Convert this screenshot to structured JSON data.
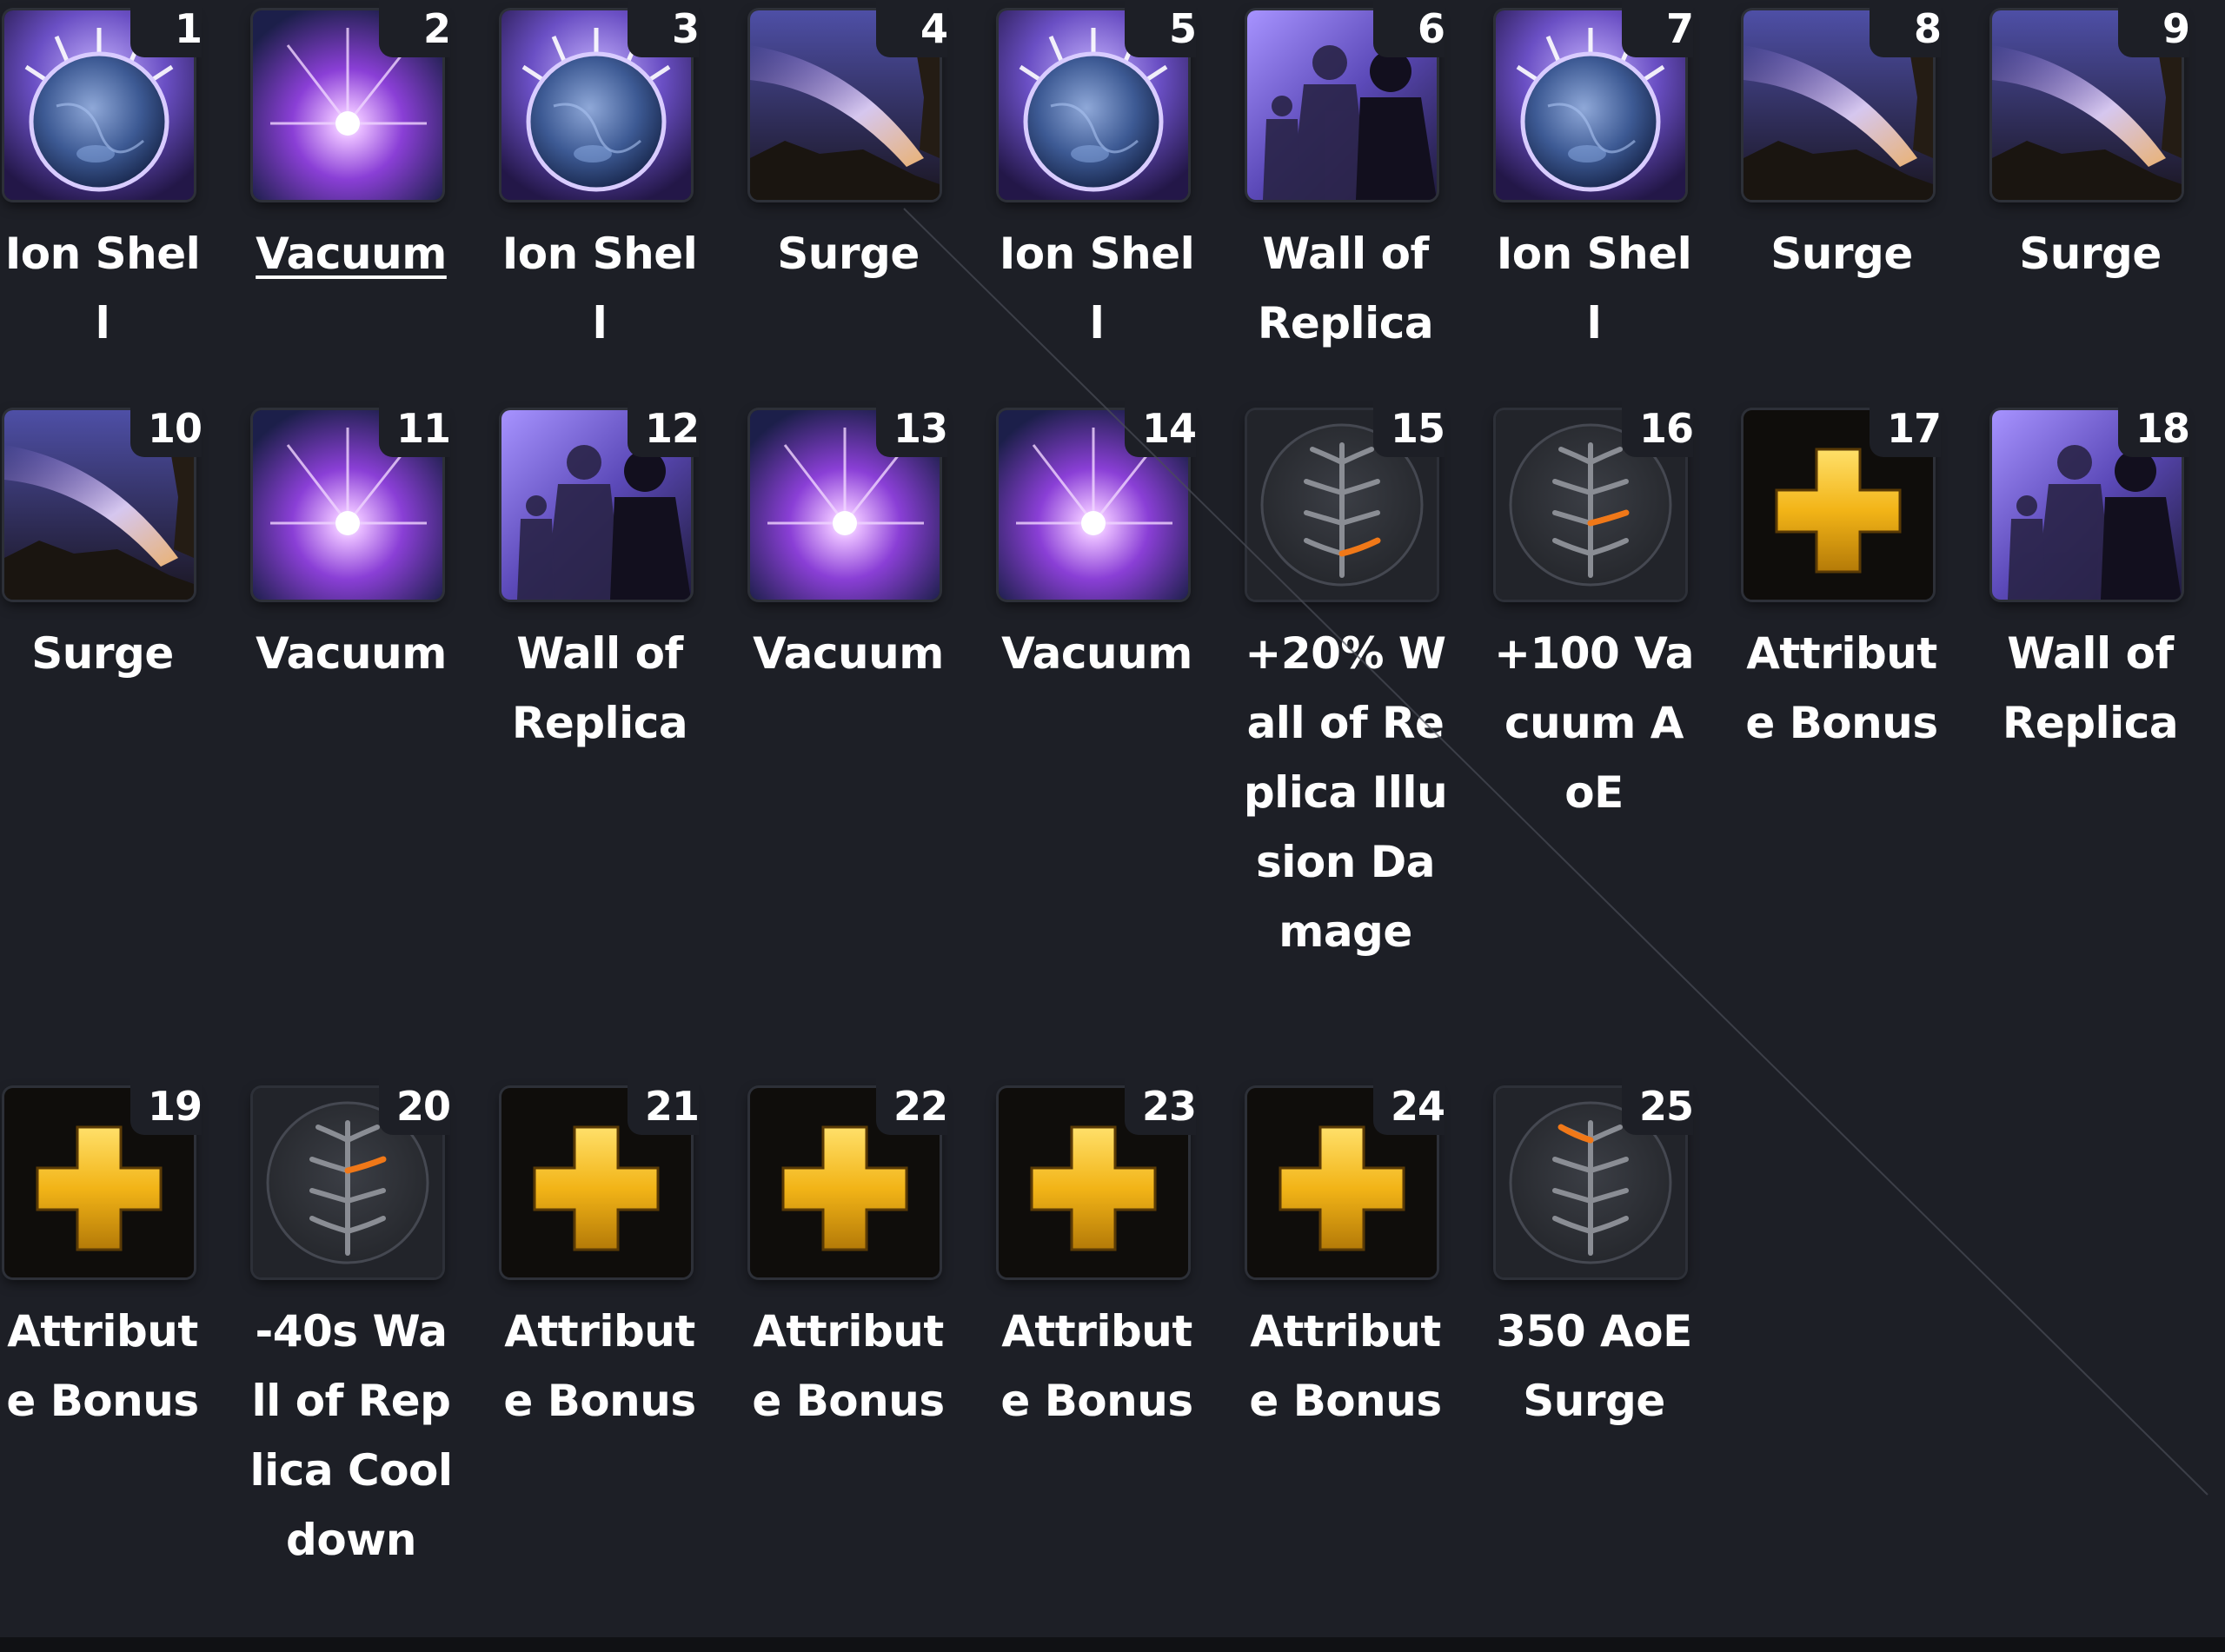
{
  "colors": {
    "background": "#1d1f26",
    "text": "#ffffff",
    "attribute_gold": "#f2b417",
    "talent_orange": "#f07818"
  },
  "rows": [
    {
      "items": [
        {
          "num": "1",
          "label": "Ion Shell",
          "icon": "ion-shell-icon"
        },
        {
          "num": "2",
          "label": "Vacuum",
          "icon": "vacuum-icon",
          "link": true
        },
        {
          "num": "3",
          "label": "Ion Shell",
          "icon": "ion-shell-icon"
        },
        {
          "num": "4",
          "label": "Surge",
          "icon": "surge-icon"
        },
        {
          "num": "5",
          "label": "Ion Shell",
          "icon": "ion-shell-icon"
        },
        {
          "num": "6",
          "label": "Wall of Replica",
          "icon": "wall-of-replica-icon"
        },
        {
          "num": "7",
          "label": "Ion Shell",
          "icon": "ion-shell-icon"
        },
        {
          "num": "8",
          "label": "Surge",
          "icon": "surge-icon"
        },
        {
          "num": "9",
          "label": "Surge",
          "icon": "surge-icon"
        }
      ]
    },
    {
      "items": [
        {
          "num": "10",
          "label": "Surge",
          "icon": "surge-icon"
        },
        {
          "num": "11",
          "label": "Vacuum",
          "icon": "vacuum-icon"
        },
        {
          "num": "12",
          "label": "Wall of Replica",
          "icon": "wall-of-replica-icon"
        },
        {
          "num": "13",
          "label": "Vacuum",
          "icon": "vacuum-icon"
        },
        {
          "num": "14",
          "label": "Vacuum",
          "icon": "vacuum-icon"
        },
        {
          "num": "15",
          "label": "+20% Wall of Replica Illusion Damage",
          "icon": "talent-tree-icon",
          "talent": "low-right"
        },
        {
          "num": "16",
          "label": "+100 Vacuum AoE",
          "icon": "talent-tree-icon",
          "talent": "mid-right"
        },
        {
          "num": "17",
          "label": "Attribute Bonus",
          "icon": "attribute-bonus-icon"
        },
        {
          "num": "18",
          "label": "Wall of Replica",
          "icon": "wall-of-replica-icon"
        }
      ]
    },
    {
      "items": [
        {
          "num": "19",
          "label": "Attribute Bonus",
          "icon": "attribute-bonus-icon"
        },
        {
          "num": "20",
          "label": "-40s Wall of Replica Cooldown",
          "icon": "talent-tree-icon",
          "talent": "upper-right"
        },
        {
          "num": "21",
          "label": "Attribute Bonus",
          "icon": "attribute-bonus-icon"
        },
        {
          "num": "22",
          "label": "Attribute Bonus",
          "icon": "attribute-bonus-icon"
        },
        {
          "num": "23",
          "label": "Attribute Bonus",
          "icon": "attribute-bonus-icon"
        },
        {
          "num": "24",
          "label": "Attribute Bonus",
          "icon": "attribute-bonus-icon"
        },
        {
          "num": "25",
          "label": "350 AoE Surge",
          "icon": "talent-tree-icon",
          "talent": "top-left"
        }
      ]
    }
  ]
}
